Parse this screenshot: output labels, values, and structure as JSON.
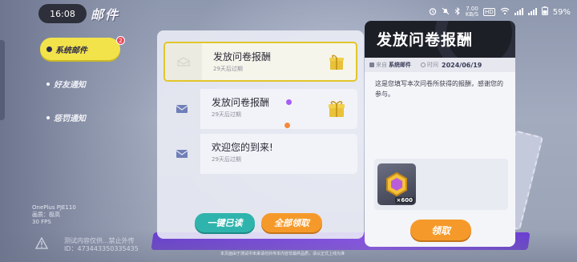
{
  "status_bar": {
    "time": "16:08",
    "net_speed_value": "7.00",
    "net_speed_unit": "KB/S",
    "network_type": "HD",
    "battery": "59%"
  },
  "app": {
    "title": "邮件"
  },
  "sidebar": {
    "badge": "2",
    "items": [
      {
        "label": "系统邮件",
        "active": true
      },
      {
        "label": "好友通知",
        "active": false
      },
      {
        "label": "惩罚通知",
        "active": false
      }
    ]
  },
  "mail_list": {
    "items": [
      {
        "title": "发放问卷报酬",
        "expiry": "29天后过期",
        "has_gift": true,
        "selected": true
      },
      {
        "title": "发放问卷报酬",
        "expiry": "29天后过期",
        "has_gift": true,
        "selected": false
      },
      {
        "title": "欢迎您的到来!",
        "expiry": "29天后过期",
        "has_gift": false,
        "selected": false
      }
    ],
    "read_all_label": "一键已读",
    "claim_all_label": "全部领取"
  },
  "detail": {
    "title": "发放问卷报酬",
    "from_label": "来自",
    "sender": "系统邮件",
    "time_label": "时间",
    "date": "2024/06/19",
    "body": "这是您填写本次问卷所获得的报酬，感谢您的参与。",
    "reward_qty": "×600",
    "claim_label": "领取"
  },
  "debug": {
    "device": "OnePlus PJE110",
    "quality": "画质：极高",
    "fps": "30 FPS",
    "warning_line1": "测试内容仅供...禁止外传",
    "warning_line2": "ID：473443350335435",
    "footer": "本页面由于测试中未来请勿外传本内容非最终品质，请以正式上线为准"
  },
  "colors": {
    "accent_yellow": "#f2e34a",
    "teal": "#2fb4ad",
    "orange": "#f59a2a",
    "purple": "#8c4ff0",
    "dark_header": "#1d1f27"
  }
}
